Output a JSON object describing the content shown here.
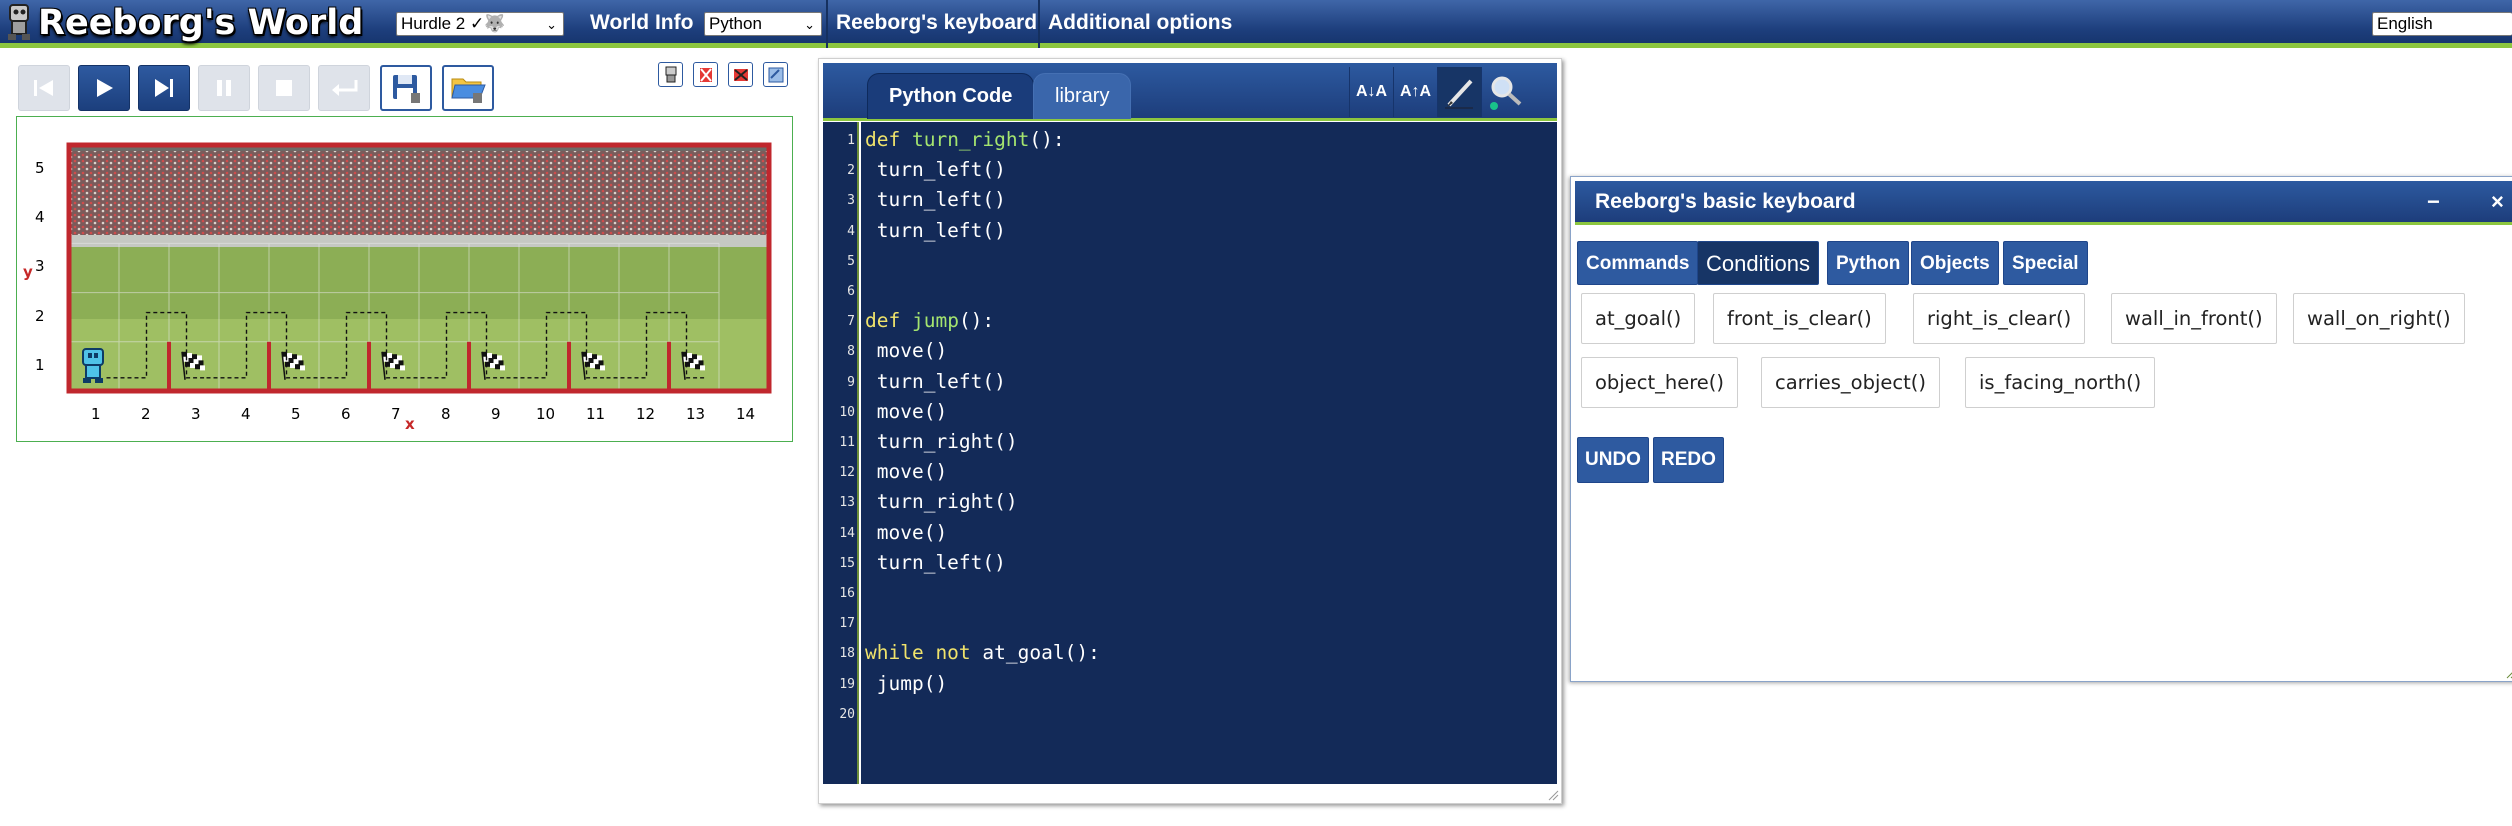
{
  "app": {
    "title": "Reeborg's World"
  },
  "topbar": {
    "world_select": "Hurdle 2 ✓🐺",
    "world_info": "World Info",
    "language_select": "Python",
    "keyboard_link": "Reeborg's keyboard",
    "options_link": "Additional options",
    "ui_language": "English"
  },
  "controls": [
    {
      "name": "reverse-step-button",
      "icon": "reverse-step-icon",
      "state": "disabled"
    },
    {
      "name": "run-button",
      "icon": "play-icon",
      "state": "active"
    },
    {
      "name": "step-button",
      "icon": "step-icon",
      "state": "active"
    },
    {
      "name": "pause-button",
      "icon": "pause-icon",
      "state": "disabled"
    },
    {
      "name": "stop-button",
      "icon": "stop-icon",
      "state": "disabled"
    },
    {
      "name": "reload-button",
      "icon": "return-icon",
      "state": "disabled"
    },
    {
      "name": "save-button",
      "icon": "save-icon",
      "state": "file"
    },
    {
      "name": "open-button",
      "icon": "open-folder-icon",
      "state": "file"
    }
  ],
  "world": {
    "y_labels": [
      "5",
      "4",
      "3",
      "2",
      "1"
    ],
    "x_labels": [
      "1",
      "2",
      "3",
      "4",
      "5",
      "6",
      "7",
      "8",
      "9",
      "10",
      "11",
      "12",
      "13",
      "14"
    ],
    "x_axis": "x",
    "y_axis": "y",
    "wall_columns": [
      2,
      4,
      6,
      8,
      10,
      12
    ],
    "flag_columns": [
      3,
      5,
      7,
      9,
      11,
      13
    ]
  },
  "editor": {
    "tab_code": "Python Code",
    "tab_library": "library",
    "btn_decrease": "A↓A",
    "btn_increase": "A↑A",
    "lines": [
      [
        {
          "t": "def ",
          "c": "kw"
        },
        {
          "t": "turn_right",
          "c": "fn"
        },
        {
          "t": "():",
          "c": ""
        }
      ],
      [
        {
          "t": " turn_left()",
          "c": ""
        }
      ],
      [
        {
          "t": " turn_left()",
          "c": ""
        }
      ],
      [
        {
          "t": " turn_left()",
          "c": ""
        }
      ],
      [],
      [],
      [
        {
          "t": "def ",
          "c": "kw"
        },
        {
          "t": "jump",
          "c": "fn"
        },
        {
          "t": "():",
          "c": ""
        }
      ],
      [
        {
          "t": " move()",
          "c": ""
        }
      ],
      [
        {
          "t": " turn_left()",
          "c": ""
        }
      ],
      [
        {
          "t": " move()",
          "c": ""
        }
      ],
      [
        {
          "t": " turn_right()",
          "c": ""
        }
      ],
      [
        {
          "t": " move()",
          "c": ""
        }
      ],
      [
        {
          "t": " turn_right()",
          "c": ""
        }
      ],
      [
        {
          "t": " move()",
          "c": ""
        }
      ],
      [
        {
          "t": " turn_left()",
          "c": ""
        }
      ],
      [],
      [],
      [
        {
          "t": "while not ",
          "c": "kw"
        },
        {
          "t": "at_goal():",
          "c": ""
        }
      ],
      [
        {
          "t": " jump()",
          "c": ""
        }
      ],
      []
    ]
  },
  "keyboard": {
    "title": "Reeborg's basic keyboard",
    "minimize": "−",
    "close": "×",
    "tabs": [
      "Commands",
      "Conditions",
      "Python",
      "Objects",
      "Special"
    ],
    "active_tab": "Conditions",
    "row1": [
      "at_goal()",
      "front_is_clear()",
      "right_is_clear()",
      "wall_in_front()",
      "wall_on_right()"
    ],
    "row2": [
      "object_here()",
      "carries_object()",
      "is_facing_north()"
    ],
    "undo": "UNDO",
    "redo": "REDO"
  },
  "colors": {
    "bar_blue": "#1d3e7c",
    "accent_green": "#8cc63f",
    "code_bg": "#132a58",
    "keyword": "#f0e36b",
    "function_name": "#a4e46f",
    "wall_red": "#c0272d"
  }
}
